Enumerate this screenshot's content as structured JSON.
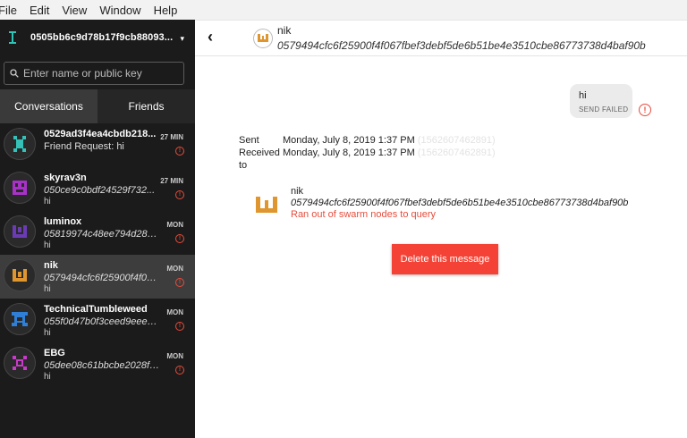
{
  "menu": [
    "File",
    "Edit",
    "View",
    "Window",
    "Help"
  ],
  "account": {
    "key": "0505bb6c9d78b17f9cb88093...",
    "caret": "▾"
  },
  "search": {
    "placeholder": "Enter name or public key"
  },
  "tabs": [
    "Conversations",
    "Friends"
  ],
  "conversations": [
    {
      "name": "0529ad3f4ea4cbdb218...",
      "sub": "Friend Request: hi",
      "preview": "",
      "time": "27 MIN",
      "color": "#35c1b8",
      "error": true
    },
    {
      "name": "skyrav3n",
      "sub": "050ce9c0bdf24529f732...",
      "preview": "hi",
      "time": "27 MIN",
      "color": "#a832c8",
      "error": true
    },
    {
      "name": "luminox",
      "sub": "05819974c48ee794d2803...",
      "preview": "hi",
      "time": "MON",
      "color": "#6b3bb5",
      "error": true
    },
    {
      "name": "nik",
      "sub": "0579494cfc6f25900f4f067...",
      "preview": "hi",
      "time": "MON",
      "color": "#e0962f",
      "error": true,
      "selected": true
    },
    {
      "name": "TechnicalTumbleweed",
      "sub": "055f0d47b0f3ceed9eee4b...",
      "preview": "hi",
      "time": "MON",
      "color": "#2f7fd6",
      "error": true
    },
    {
      "name": "EBG",
      "sub": "05dee08c61bbcbe2028f9b...",
      "preview": "hi",
      "time": "MON",
      "color": "#c83ac8",
      "error": true
    }
  ],
  "header": {
    "name": "nik",
    "key": "0579494cfc6f25900f4f067fbef3debf5de6b51be4e3510cbe86773738d4baf90b"
  },
  "message": {
    "text": "hi",
    "status": "SEND FAILED"
  },
  "details": {
    "sent_label": "Sent",
    "sent_value": "Monday, July 8, 2019 1:37 PM",
    "sent_ts": "(1562607462891)",
    "received_label": "Received to",
    "received_value": "Monday, July 8, 2019 1:37 PM",
    "received_ts": "(1562607462891)"
  },
  "error": {
    "name": "nik",
    "key": "0579494cfc6f25900f4f067fbef3debf5de6b51be4e3510cbe86773738d4baf90b",
    "message": "Ran out of swarm nodes to query"
  },
  "delete_button": "Delete this message",
  "colors": {
    "accent_red": "#f44336",
    "error_red": "#e74c3c",
    "sidebar": "#1b1b1b"
  }
}
